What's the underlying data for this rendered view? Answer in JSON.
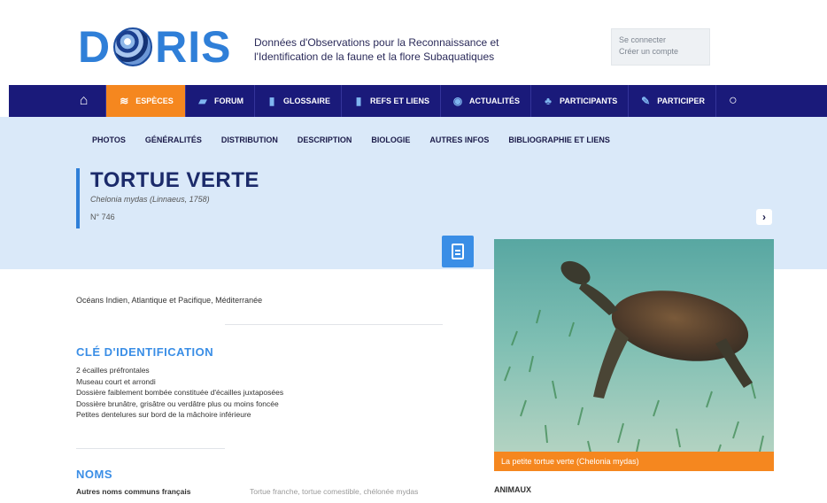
{
  "header": {
    "logo_left": "D",
    "logo_right": "RIS",
    "tagline_line1": "Données d'Observations pour la Reconnaissance et",
    "tagline_line2": "l'Identification de la faune et la flore Subaquatiques",
    "login_line1": "Se connecter",
    "login_line2": "Créer un compte"
  },
  "nav": {
    "home_icon": "home-icon",
    "items": [
      {
        "label": "ESPÈCES",
        "icon": "fish-icon"
      },
      {
        "label": "FORUM",
        "icon": "chat-icon"
      },
      {
        "label": "GLOSSAIRE",
        "icon": "book-icon"
      },
      {
        "label": "REFS ET LIENS",
        "icon": "bookmark-icon"
      },
      {
        "label": "ACTUALITÉS",
        "icon": "news-icon"
      },
      {
        "label": "PARTICIPANTS",
        "icon": "users-icon"
      },
      {
        "label": "PARTICIPER",
        "icon": "pencil-icon"
      }
    ],
    "search_icon": "search-icon",
    "active_color": "#f5871f",
    "bar_color": "#1a1a7a"
  },
  "subnav": {
    "items": [
      "PHOTOS",
      "GÉNÉRALITÉS",
      "DISTRIBUTION",
      "DESCRIPTION",
      "BIOLOGIE",
      "AUTRES INFOS",
      "BIBLIOGRAPHIE ET LIENS"
    ]
  },
  "species": {
    "title": "TORTUE VERTE",
    "scientific": "Chelonia mydas (Linnaeus, 1758)",
    "number": "N° 746"
  },
  "photo": {
    "caption": "La petite tortue verte (Chelonia mydas)"
  },
  "content": {
    "distribution": "Océans Indien, Atlantique et Pacifique, Méditerranée",
    "cle_title": "CLÉ D'IDENTIFICATION",
    "cle_items": [
      "2 écailles préfrontales",
      "Museau court et arrondi",
      "Dossière faiblement bombée constituée d'écailles juxtaposées",
      "Dossière brunâtre, grisâtre ou verdâtre plus ou moins foncée",
      "Petites dentelures sur bord de la mâchoire inférieure"
    ],
    "noms_title": "NOMS",
    "noms_label": "Autres noms communs français",
    "noms_value": "Tortue franche, tortue comestible, chélonée mydas",
    "animaux": "ANIMAUX"
  }
}
